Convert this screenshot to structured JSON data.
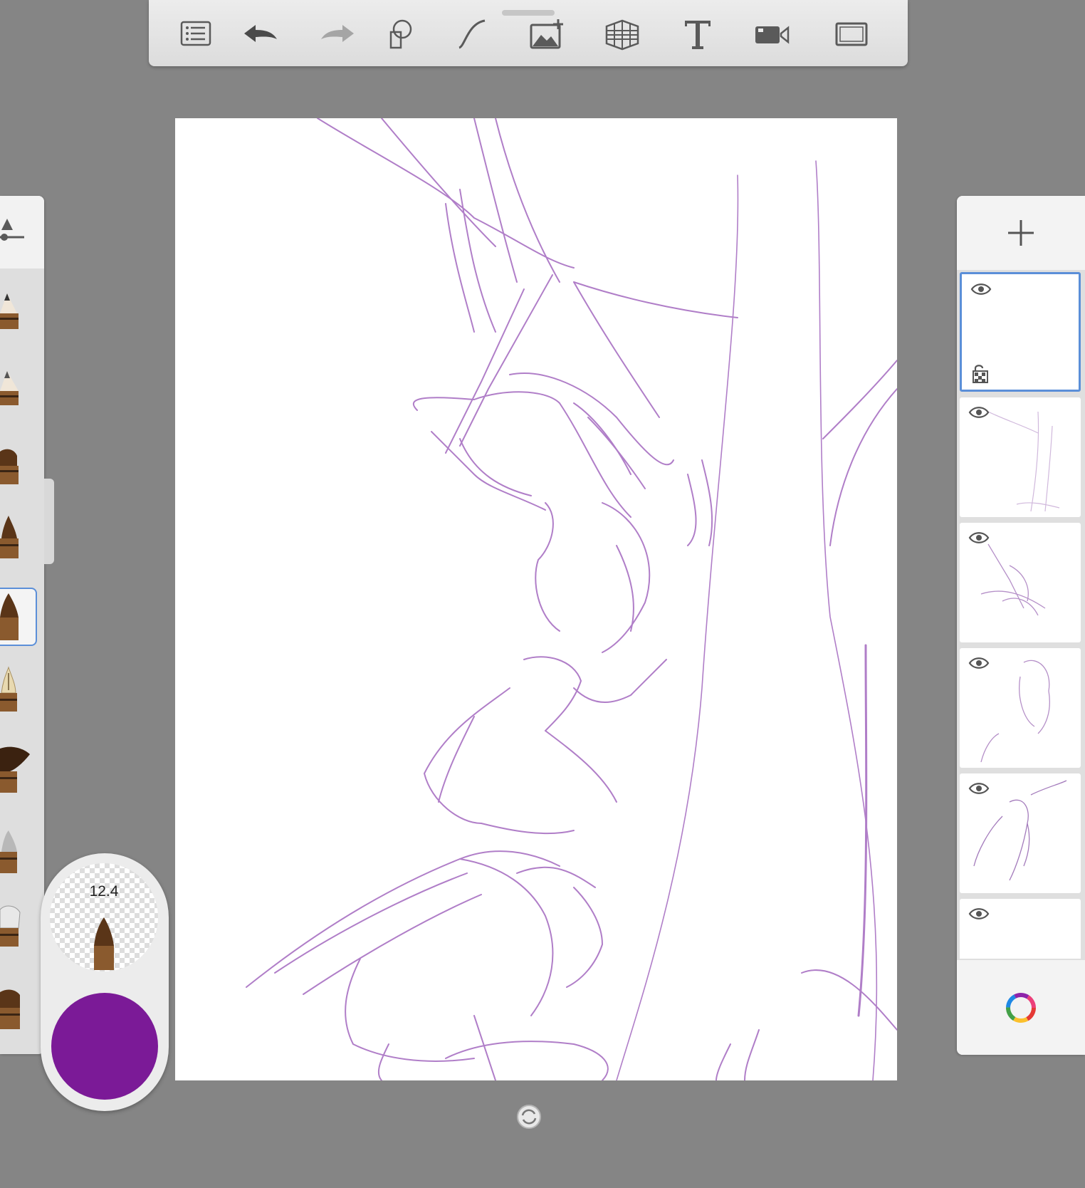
{
  "toolbar": {
    "buttons": [
      {
        "name": "list-icon",
        "enabled": true
      },
      {
        "name": "undo-icon",
        "enabled": true
      },
      {
        "name": "redo-icon",
        "enabled": false
      },
      {
        "name": "selection-tool-icon",
        "enabled": true
      },
      {
        "name": "curve-tool-icon",
        "enabled": true
      },
      {
        "name": "add-image-icon",
        "enabled": true
      },
      {
        "name": "perspective-grid-icon",
        "enabled": true
      },
      {
        "name": "text-tool-icon",
        "enabled": true
      },
      {
        "name": "time-lapse-camera-icon",
        "enabled": true
      },
      {
        "name": "fullscreen-icon",
        "enabled": true
      }
    ]
  },
  "brushes": {
    "items": [
      {
        "name": "pencil-brush"
      },
      {
        "name": "pencil-fine-brush"
      },
      {
        "name": "flat-brush"
      },
      {
        "name": "pointed-brush"
      },
      {
        "name": "round-brush",
        "selected": true
      },
      {
        "name": "ink-pen-brush"
      },
      {
        "name": "fan-brush"
      },
      {
        "name": "airbrush"
      },
      {
        "name": "smudge-brush"
      },
      {
        "name": "stamp-brush"
      }
    ]
  },
  "brush_puck": {
    "size_value": "12.4",
    "current_color": "#7b1a97"
  },
  "layers": {
    "items": [
      {
        "name": "layer-1",
        "visible": true,
        "selected": true
      },
      {
        "name": "layer-2",
        "visible": true
      },
      {
        "name": "layer-3",
        "visible": true
      },
      {
        "name": "layer-4",
        "visible": true
      },
      {
        "name": "layer-5",
        "visible": true
      },
      {
        "name": "layer-6",
        "visible": true
      }
    ]
  },
  "colors": {
    "sketch_stroke": "#b07ec8",
    "selection_border": "#5b8fd8",
    "background": "#858585",
    "icon": "#5a5a5a"
  }
}
